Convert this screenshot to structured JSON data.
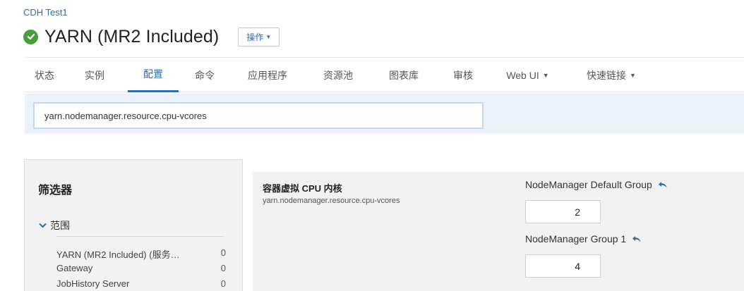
{
  "header": {
    "cluster_name": "CDH Test1",
    "service_title": "YARN (MR2 Included)",
    "actions_label": "操作",
    "status": "good",
    "status_color": "#4a9e3a"
  },
  "tabs": [
    {
      "label": "状态"
    },
    {
      "label": "实例"
    },
    {
      "label": "配置",
      "active": true
    },
    {
      "label": "命令"
    },
    {
      "label": "应用程序"
    },
    {
      "label": "资源池"
    },
    {
      "label": "图表库"
    },
    {
      "label": "审核"
    },
    {
      "label": "Web UI",
      "dropdown": true
    },
    {
      "label": "快速链接",
      "dropdown": true
    }
  ],
  "search": {
    "value": "yarn.nodemanager.resource.cpu-vcores"
  },
  "filters": {
    "title": "筛选器",
    "scope_label": "范围",
    "scope_items": [
      {
        "label": "YARN (MR2 Included) (服务…",
        "count": "0"
      },
      {
        "label": "Gateway",
        "count": "0"
      },
      {
        "label": "JobHistory Server",
        "count": "0"
      }
    ]
  },
  "config": {
    "display_name": "容器虚拟 CPU 内核",
    "property_key": "yarn.nodemanager.resource.cpu-vcores",
    "groups": [
      {
        "name": "NodeManager Default Group",
        "value": "2"
      },
      {
        "name": "NodeManager Group 1",
        "value": "4"
      }
    ]
  },
  "colors": {
    "accent": "#2a6fb0",
    "search_band": "#eaf1f8",
    "panel_bg": "#f2f2f2"
  }
}
